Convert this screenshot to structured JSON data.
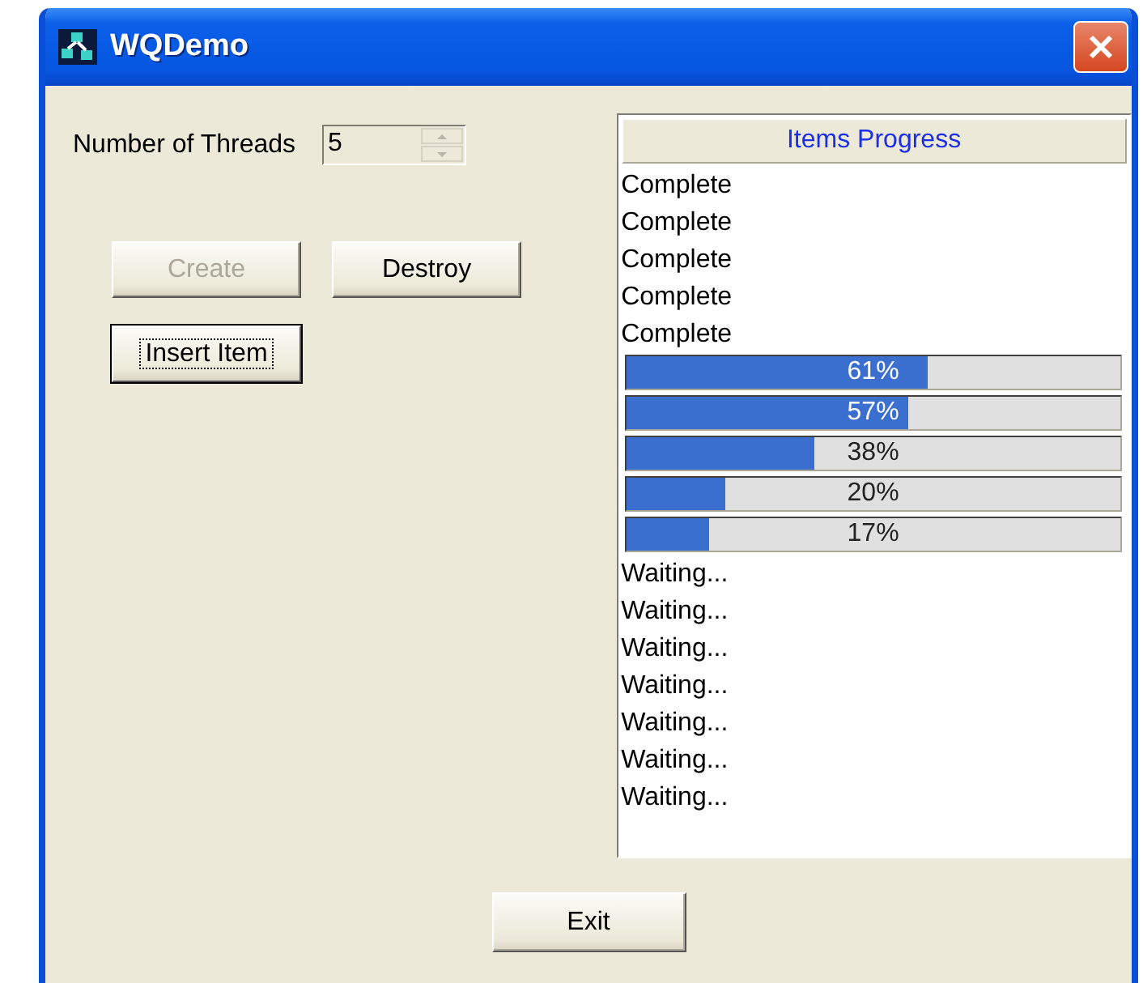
{
  "window": {
    "title": "WQDemo"
  },
  "threads": {
    "label": "Number of Threads",
    "value": "5"
  },
  "buttons": [
    {
      "label": "Create",
      "disabled": true,
      "focused": false
    },
    {
      "label": "Destroy",
      "disabled": false,
      "focused": false
    },
    {
      "label": "Insert Item",
      "disabled": false,
      "focused": true
    }
  ],
  "list": {
    "header": "Items Progress",
    "items": [
      {
        "kind": "text",
        "text": "Complete"
      },
      {
        "kind": "text",
        "text": "Complete"
      },
      {
        "kind": "text",
        "text": "Complete"
      },
      {
        "kind": "text",
        "text": "Complete"
      },
      {
        "kind": "text",
        "text": "Complete"
      },
      {
        "kind": "progress",
        "level": 0.61,
        "reading": "61%"
      },
      {
        "kind": "progress",
        "level": 0.57,
        "reading": "57%"
      },
      {
        "kind": "progress",
        "level": 0.38,
        "reading": "38%"
      },
      {
        "kind": "progress",
        "level": 0.2,
        "reading": "20%"
      },
      {
        "kind": "progress",
        "level": 0.17,
        "reading": "17%"
      },
      {
        "kind": "text",
        "text": "Waiting..."
      },
      {
        "kind": "text",
        "text": "Waiting..."
      },
      {
        "kind": "text",
        "text": "Waiting..."
      },
      {
        "kind": "text",
        "text": "Waiting..."
      },
      {
        "kind": "text",
        "text": "Waiting..."
      },
      {
        "kind": "text",
        "text": "Waiting..."
      },
      {
        "kind": "text",
        "text": "Waiting..."
      }
    ]
  },
  "exit_button": {
    "label": "Exit"
  }
}
